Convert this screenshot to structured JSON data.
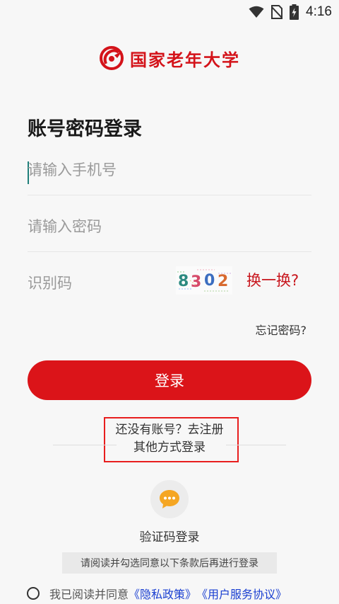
{
  "status_bar": {
    "time": "4:16",
    "icons": [
      "wifi-icon",
      "no-sim-icon",
      "battery-charging-icon"
    ]
  },
  "logo": {
    "text": "国家老年大学",
    "icon": "university-emblem-icon",
    "color": "#d4131a"
  },
  "page_title": "账号密码登录",
  "phone_field": {
    "placeholder": "请输入手机号",
    "value": ""
  },
  "password_field": {
    "placeholder": "请输入密码",
    "value": ""
  },
  "captcha_field": {
    "placeholder": "识别码",
    "value": "",
    "captcha_code": "8302",
    "refresh_label": "换一换?"
  },
  "forgot_password": "忘记密码?",
  "login_button": {
    "label": "登录",
    "color": "#db1419"
  },
  "register_link": "还没有账号？去注册",
  "other_methods_label": "其他方式登录",
  "sms_login": {
    "label": "验证码登录",
    "icon": "chat-bubble-icon"
  },
  "agreement_tip": "请阅读并勾选同意以下条款后再进行登录",
  "agreement": {
    "prefix": "我已阅读并同意",
    "privacy_link": "《隐私政策》",
    "terms_link": "《用户服务协议》"
  }
}
